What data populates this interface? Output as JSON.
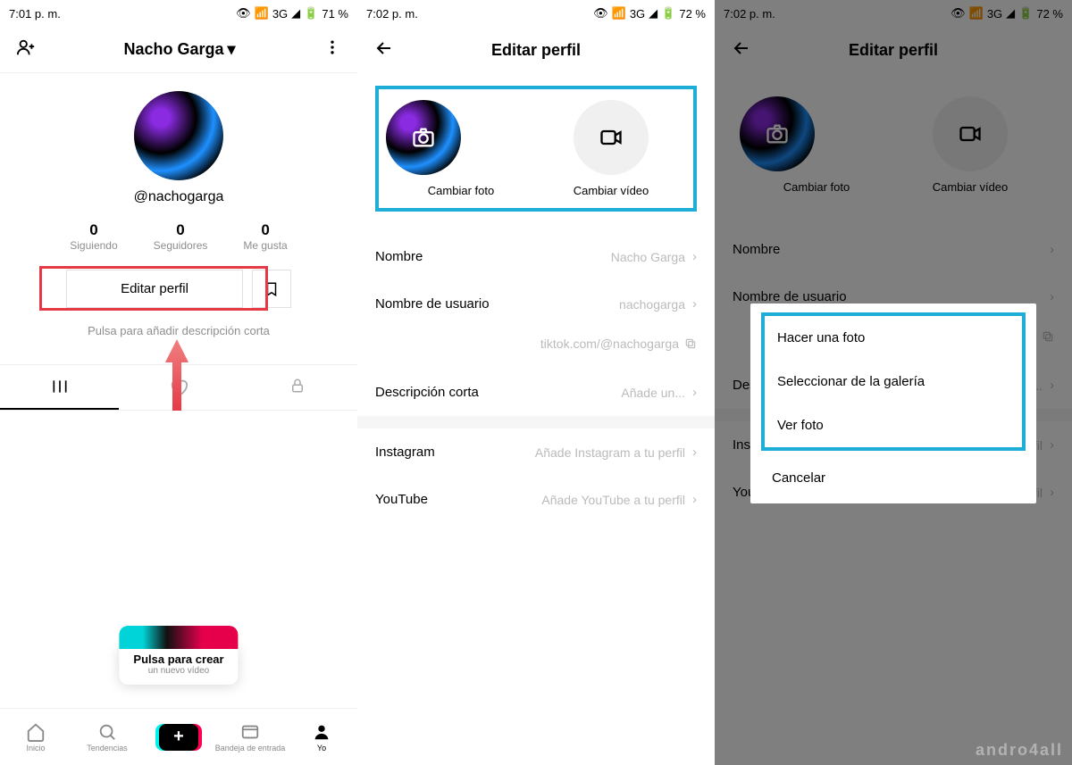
{
  "screen1": {
    "status": {
      "time": "7:01 p. m.",
      "net": "3G",
      "battery": "71 %"
    },
    "header": {
      "name": "Nacho Garga"
    },
    "handle": "@nachogarga",
    "stats": {
      "following": {
        "count": "0",
        "label": "Siguiendo"
      },
      "followers": {
        "count": "0",
        "label": "Seguidores"
      },
      "likes": {
        "count": "0",
        "label": "Me gusta"
      }
    },
    "edit_label": "Editar perfil",
    "bio_hint": "Pulsa para añadir descripción corta",
    "tip": {
      "title": "Pulsa para crear",
      "subtitle": "un nuevo vídeo"
    },
    "nav": {
      "home": "Inicio",
      "trends": "Tendencias",
      "inbox": "Bandeja de entrada",
      "me": "Yo"
    }
  },
  "screen2": {
    "status": {
      "time": "7:02 p. m.",
      "net": "3G",
      "battery": "72 %"
    },
    "title": "Editar perfil",
    "change_photo": "Cambiar foto",
    "change_video": "Cambiar vídeo",
    "fields": {
      "name": {
        "label": "Nombre",
        "value": "Nacho Garga"
      },
      "username": {
        "label": "Nombre de usuario",
        "value": "nachogarga"
      },
      "link": "tiktok.com/@nachogarga",
      "bio": {
        "label": "Descripción corta",
        "value": "Añade un..."
      },
      "instagram": {
        "label": "Instagram",
        "value": "Añade Instagram a tu perfil"
      },
      "youtube": {
        "label": "YouTube",
        "value": "Añade YouTube a tu perfil"
      }
    }
  },
  "screen3": {
    "status": {
      "time": "7:02 p. m.",
      "net": "3G",
      "battery": "72 %"
    },
    "title": "Editar perfil",
    "change_photo": "Cambiar foto",
    "change_video": "Cambiar vídeo",
    "dialog": {
      "take": "Hacer una foto",
      "gallery": "Seleccionar de la galería",
      "view": "Ver foto",
      "cancel": "Cancelar"
    },
    "fields": {
      "name_l": "Nombre",
      "user_l": "Nombre de usuario",
      "bio_l": "Descripción corta",
      "ig_l": "Instagram",
      "ig_v": "Añade Instagram a tu perfil",
      "yt_l": "YouTube",
      "yt_v": "Añade YouTube a tu perfil",
      "bio_v": "Añade un..."
    }
  },
  "watermark": "andro4all"
}
